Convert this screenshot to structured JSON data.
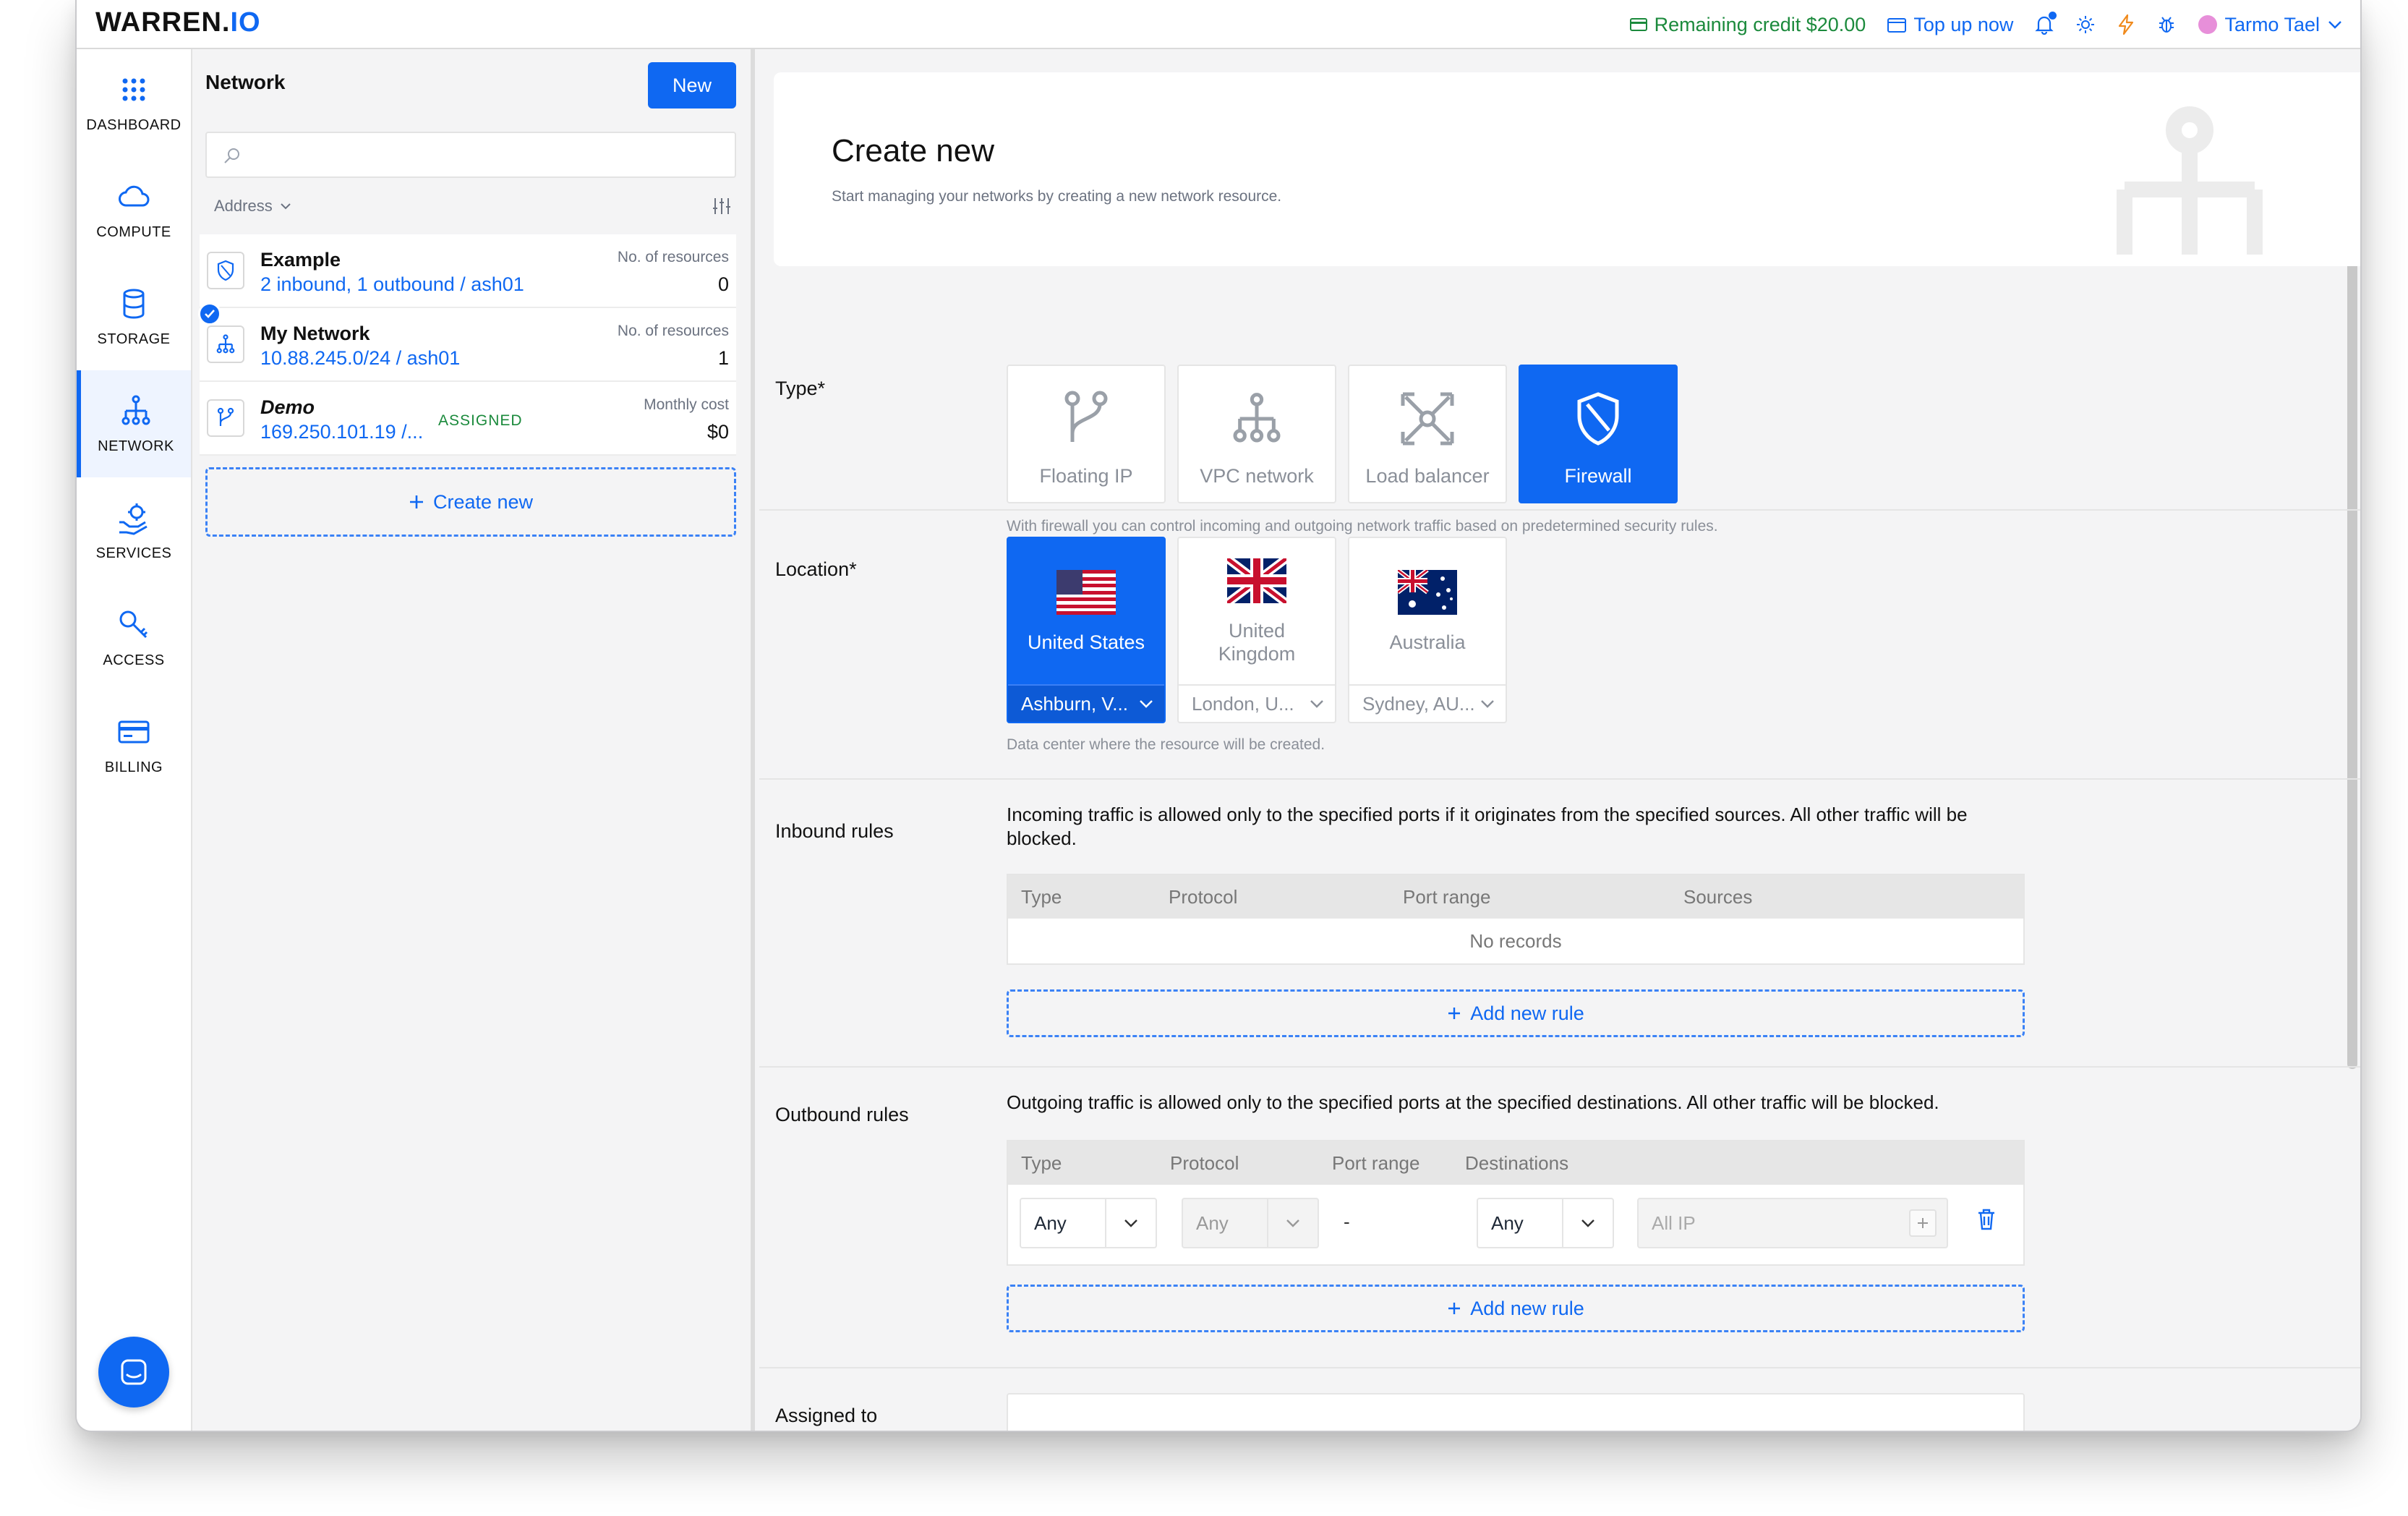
{
  "app": {
    "logo_main": "WARREN.",
    "logo_accent": "IO"
  },
  "topbar": {
    "credit": "Remaining credit $20.00",
    "topup": "Top up now",
    "user": "Tarmo Tael"
  },
  "sidebar": {
    "items": [
      {
        "label": "DASHBOARD"
      },
      {
        "label": "COMPUTE"
      },
      {
        "label": "STORAGE"
      },
      {
        "label": "NETWORK"
      },
      {
        "label": "SERVICES"
      },
      {
        "label": "ACCESS"
      },
      {
        "label": "BILLING"
      }
    ]
  },
  "list": {
    "title": "Network",
    "new_button": "New",
    "search_placeholder": "",
    "sort_label": "Address",
    "rows": [
      {
        "name": "Example",
        "sub": "2 inbound, 1 outbound / ash01",
        "meta_label": "No. of resources",
        "meta_value": "0"
      },
      {
        "name": "My Network",
        "sub": "10.88.245.0/24 / ash01",
        "meta_label": "No. of resources",
        "meta_value": "1"
      },
      {
        "name": "Demo",
        "sub": "169.250.101.19 /...",
        "badge": "ASSIGNED",
        "meta_label": "Monthly cost",
        "meta_value": "$0"
      }
    ],
    "create_new": "Create new"
  },
  "main": {
    "hero_title": "Create new",
    "hero_subtitle": "Start managing your networks by creating a new network resource.",
    "type_label": "Type*",
    "types": [
      {
        "label": "Floating IP",
        "icon": "branch-icon",
        "selected": false
      },
      {
        "label": "VPC network",
        "icon": "network-icon",
        "selected": false
      },
      {
        "label": "Load balancer",
        "icon": "load-balancer-icon",
        "selected": false
      },
      {
        "label": "Firewall",
        "icon": "shield-icon",
        "selected": true
      }
    ],
    "type_help": "With firewall you can control incoming and outgoing network traffic based on predetermined security rules.",
    "location_label": "Location*",
    "locations": [
      {
        "label": "United States",
        "dc": "Ashburn, V...",
        "flag": "us",
        "selected": true
      },
      {
        "label": "United Kingdom",
        "dc": "London, U...",
        "flag": "uk",
        "selected": false
      },
      {
        "label": "Australia",
        "dc": "Sydney, AU...",
        "flag": "au",
        "selected": false
      }
    ],
    "location_help": "Data center where the resource will be created.",
    "inbound": {
      "label": "Inbound rules",
      "text": "Incoming traffic is allowed only to the specified ports if it originates from the specified sources. All other traffic will be blocked.",
      "columns": [
        "Type",
        "Protocol",
        "Port range",
        "Sources"
      ],
      "empty": "No records",
      "add": "Add new rule"
    },
    "outbound": {
      "label": "Outbound rules",
      "text": "Outgoing traffic is allowed only to the specified ports at the specified destinations. All other traffic will be blocked.",
      "columns": [
        "Type",
        "Protocol",
        "Port range",
        "Destinations"
      ],
      "row": {
        "type": "Any",
        "protocol": "Any",
        "port_range": "-",
        "destination": "Any",
        "ip_placeholder": "All IP"
      },
      "add": "Add new rule"
    },
    "assigned_label": "Assigned to"
  },
  "colors": {
    "accent": "#0f68f2",
    "success": "#1b8a3c",
    "warning": "#f08a1c"
  }
}
